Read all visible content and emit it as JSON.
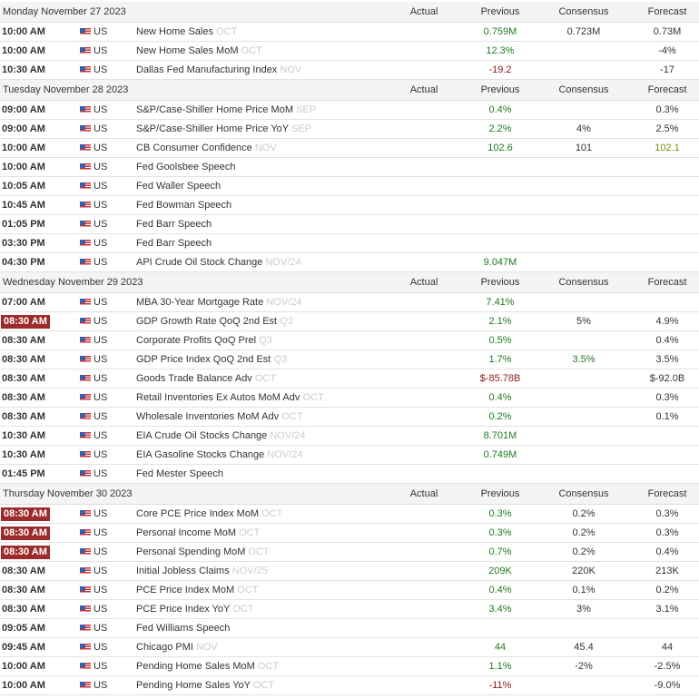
{
  "headers": {
    "actual": "Actual",
    "previous": "Previous",
    "consensus": "Consensus",
    "forecast": "Forecast"
  },
  "colors": {
    "up": "#1e7b1e",
    "down": "#8b1a1a",
    "highlight": "#9e2b2b"
  },
  "days": [
    {
      "date": "Monday November 27 2023",
      "rows": [
        {
          "time": "10:00 AM",
          "country": "US",
          "event": "New Home Sales",
          "ref": "OCT",
          "actual": "",
          "previous": "0.759M",
          "prev_tone": "up",
          "consensus": "0.723M",
          "forecast": "0.73M"
        },
        {
          "time": "10:00 AM",
          "country": "US",
          "event": "New Home Sales MoM",
          "ref": "OCT",
          "actual": "",
          "previous": "12.3%",
          "prev_tone": "up",
          "consensus": "",
          "forecast": "-4%"
        },
        {
          "time": "10:30 AM",
          "country": "US",
          "event": "Dallas Fed Manufacturing Index",
          "ref": "NOV",
          "actual": "",
          "previous": "-19.2",
          "prev_tone": "down",
          "consensus": "",
          "forecast": "-17"
        }
      ]
    },
    {
      "date": "Tuesday November 28 2023",
      "rows": [
        {
          "time": "09:00 AM",
          "country": "US",
          "event": "S&P/Case-Shiller Home Price MoM",
          "ref": "SEP",
          "actual": "",
          "previous": "0.4%",
          "prev_tone": "up",
          "consensus": "",
          "forecast": "0.3%"
        },
        {
          "time": "09:00 AM",
          "country": "US",
          "event": "S&P/Case-Shiller Home Price YoY",
          "ref": "SEP",
          "actual": "",
          "previous": "2.2%",
          "prev_tone": "up",
          "consensus": "4%",
          "forecast": "2.5%"
        },
        {
          "time": "10:00 AM",
          "country": "US",
          "event": "CB Consumer Confidence",
          "ref": "NOV",
          "actual": "",
          "previous": "102.6",
          "prev_tone": "up",
          "consensus": "101",
          "forecast": "102.1",
          "fc_tone": "olive"
        },
        {
          "time": "10:00 AM",
          "country": "US",
          "event": "Fed Goolsbee Speech",
          "ref": "",
          "actual": "",
          "previous": "",
          "consensus": "",
          "forecast": ""
        },
        {
          "time": "10:05 AM",
          "country": "US",
          "event": "Fed Waller Speech",
          "ref": "",
          "actual": "",
          "previous": "",
          "consensus": "",
          "forecast": ""
        },
        {
          "time": "10:45 AM",
          "country": "US",
          "event": "Fed Bowman Speech",
          "ref": "",
          "actual": "",
          "previous": "",
          "consensus": "",
          "forecast": ""
        },
        {
          "time": "01:05 PM",
          "country": "US",
          "event": "Fed Barr Speech",
          "ref": "",
          "actual": "",
          "previous": "",
          "consensus": "",
          "forecast": ""
        },
        {
          "time": "03:30 PM",
          "country": "US",
          "event": "Fed Barr Speech",
          "ref": "",
          "actual": "",
          "previous": "",
          "consensus": "",
          "forecast": ""
        },
        {
          "time": "04:30 PM",
          "country": "US",
          "event": "API Crude Oil Stock Change",
          "ref": "NOV/24",
          "actual": "",
          "previous": "9.047M",
          "prev_tone": "up",
          "consensus": "",
          "forecast": ""
        }
      ]
    },
    {
      "date": "Wednesday November 29 2023",
      "rows": [
        {
          "time": "07:00 AM",
          "country": "US",
          "event": "MBA 30-Year Mortgage Rate",
          "ref": "NOV/24",
          "actual": "",
          "previous": "7.41%",
          "prev_tone": "up",
          "consensus": "",
          "forecast": ""
        },
        {
          "time": "08:30 AM",
          "highlight": true,
          "country": "US",
          "event": "GDP Growth Rate QoQ 2nd Est",
          "ref": "Q3",
          "actual": "",
          "previous": "2.1%",
          "prev_tone": "up",
          "consensus": "5%",
          "forecast": "4.9%"
        },
        {
          "time": "08:30 AM",
          "country": "US",
          "event": "Corporate Profits QoQ Prel",
          "ref": "Q3",
          "actual": "",
          "previous": "0.5%",
          "prev_tone": "up",
          "consensus": "",
          "forecast": "0.4%"
        },
        {
          "time": "08:30 AM",
          "country": "US",
          "event": "GDP Price Index QoQ 2nd Est",
          "ref": "Q3",
          "actual": "",
          "previous": "1.7%",
          "prev_tone": "up",
          "consensus": "3.5%",
          "cons_tone": "up",
          "forecast": "3.5%"
        },
        {
          "time": "08:30 AM",
          "country": "US",
          "event": "Goods Trade Balance Adv",
          "ref": "OCT",
          "actual": "",
          "previous": "$-85.78B",
          "prev_tone": "down",
          "consensus": "",
          "forecast": "$-92.0B"
        },
        {
          "time": "08:30 AM",
          "country": "US",
          "event": "Retail Inventories Ex Autos MoM Adv",
          "ref": "OCT",
          "actual": "",
          "previous": "0.4%",
          "prev_tone": "up",
          "consensus": "",
          "forecast": "0.3%"
        },
        {
          "time": "08:30 AM",
          "country": "US",
          "event": "Wholesale Inventories MoM Adv",
          "ref": "OCT",
          "actual": "",
          "previous": "0.2%",
          "prev_tone": "up",
          "consensus": "",
          "forecast": "0.1%"
        },
        {
          "time": "10:30 AM",
          "country": "US",
          "event": "EIA Crude Oil Stocks Change",
          "ref": "NOV/24",
          "actual": "",
          "previous": "8.701M",
          "prev_tone": "up",
          "consensus": "",
          "forecast": ""
        },
        {
          "time": "10:30 AM",
          "country": "US",
          "event": "EIA Gasoline Stocks Change",
          "ref": "NOV/24",
          "actual": "",
          "previous": "0.749M",
          "prev_tone": "up",
          "consensus": "",
          "forecast": ""
        },
        {
          "time": "01:45 PM",
          "country": "US",
          "event": "Fed Mester Speech",
          "ref": "",
          "actual": "",
          "previous": "",
          "consensus": "",
          "forecast": ""
        }
      ]
    },
    {
      "date": "Thursday November 30 2023",
      "rows": [
        {
          "time": "08:30 AM",
          "highlight": true,
          "country": "US",
          "event": "Core PCE Price Index MoM",
          "ref": "OCT",
          "actual": "",
          "previous": "0.3%",
          "prev_tone": "up",
          "consensus": "0.2%",
          "forecast": "0.3%"
        },
        {
          "time": "08:30 AM",
          "highlight": true,
          "country": "US",
          "event": "Personal Income MoM",
          "ref": "OCT",
          "actual": "",
          "previous": "0.3%",
          "prev_tone": "up",
          "consensus": "0.2%",
          "forecast": "0.3%"
        },
        {
          "time": "08:30 AM",
          "highlight": true,
          "country": "US",
          "event": "Personal Spending MoM",
          "ref": "OCT",
          "actual": "",
          "previous": "0.7%",
          "prev_tone": "up",
          "consensus": "0.2%",
          "forecast": "0.4%"
        },
        {
          "time": "08:30 AM",
          "country": "US",
          "event": "Initial Jobless Claims",
          "ref": "NOV/25",
          "actual": "",
          "previous": "209K",
          "prev_tone": "up",
          "consensus": "220K",
          "forecast": "213K"
        },
        {
          "time": "08:30 AM",
          "country": "US",
          "event": "PCE Price Index MoM",
          "ref": "OCT",
          "actual": "",
          "previous": "0.4%",
          "prev_tone": "up",
          "consensus": "0.1%",
          "forecast": "0.2%"
        },
        {
          "time": "08:30 AM",
          "country": "US",
          "event": "PCE Price Index YoY",
          "ref": "OCT",
          "actual": "",
          "previous": "3.4%",
          "prev_tone": "up",
          "consensus": "3%",
          "forecast": "3.1%"
        },
        {
          "time": "09:05 AM",
          "country": "US",
          "event": "Fed Williams Speech",
          "ref": "",
          "actual": "",
          "previous": "",
          "consensus": "",
          "forecast": ""
        },
        {
          "time": "09:45 AM",
          "country": "US",
          "event": "Chicago PMI",
          "ref": "NOV",
          "actual": "",
          "previous": "44",
          "prev_tone": "up",
          "consensus": "45.4",
          "forecast": "44"
        },
        {
          "time": "10:00 AM",
          "country": "US",
          "event": "Pending Home Sales MoM",
          "ref": "OCT",
          "actual": "",
          "previous": "1.1%",
          "prev_tone": "up",
          "consensus": "-2%",
          "forecast": "-2.5%"
        },
        {
          "time": "10:00 AM",
          "country": "US",
          "event": "Pending Home Sales YoY",
          "ref": "OCT",
          "actual": "",
          "previous": "-11%",
          "prev_tone": "down",
          "consensus": "",
          "forecast": "-9.0%"
        }
      ]
    }
  ]
}
